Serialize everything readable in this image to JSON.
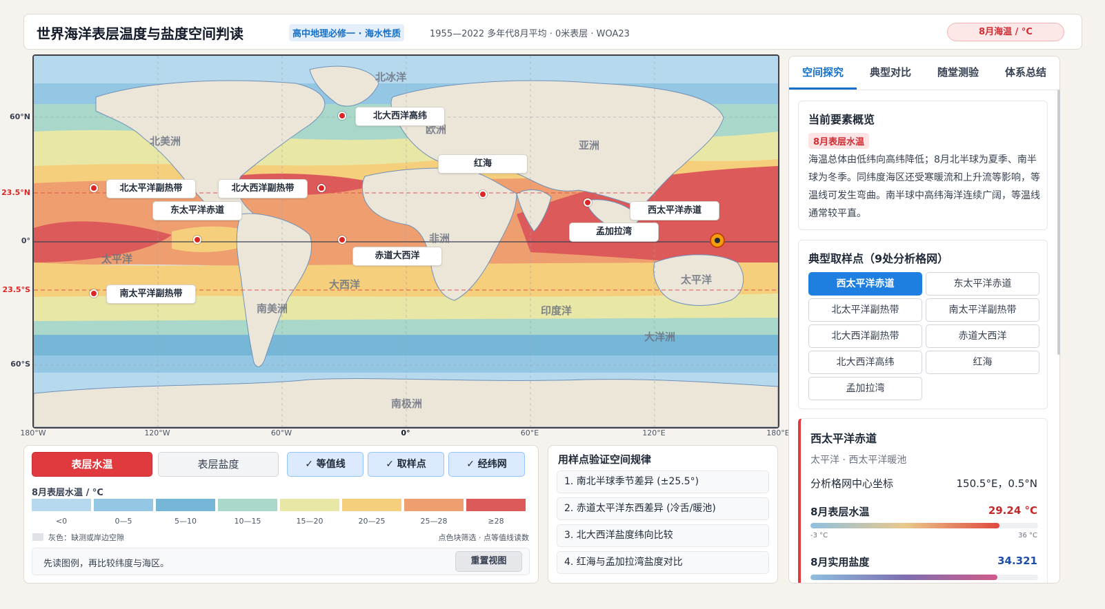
{
  "header": {
    "title": "世界海洋表层温度与盐度空间判读",
    "subject_tag": "高中地理必修一 · 海水性质",
    "meta": "1955—2022 多年代8月平均 · 0米表层 · WOA23",
    "mode_badge": "8月海温 / °C"
  },
  "map": {
    "lat_labels": [
      "60°N",
      "23.5°N",
      "0°",
      "23.5°S",
      "60°S"
    ],
    "lon_labels": [
      "180°W",
      "120°W",
      "60°W",
      "0°",
      "60°E",
      "120°E",
      "180°E"
    ],
    "continent_labels": [
      "北冰洋",
      "北美洲",
      "欧洲",
      "亚洲",
      "非洲",
      "太平洋",
      "大西洋",
      "南美洲",
      "印度洋",
      "太平洋",
      "大洋洲",
      "南极洲"
    ],
    "callouts": [
      "北大西洋高纬",
      "红海",
      "北太平洋副热带",
      "北大西洋副热带",
      "东太平洋赤道",
      "西太平洋赤道",
      "孟加拉湾",
      "赤道大西洋",
      "南太平洋副热带"
    ],
    "colors": {
      "lt0": "#b7d9ee",
      "c0_5": "#94c7e3",
      "c5_10": "#76b6d6",
      "c10_15": "#a9d8ca",
      "c15_20": "#e9e7a6",
      "c20_25": "#f5cf7c",
      "c25_28": "#ee9e6f",
      "ge28": "#dd5a5a",
      "land": "#ece6d9",
      "tropic_line": "#e05252"
    }
  },
  "controls": {
    "temp_btn": "表层水温",
    "salinity_btn": "表层盐度",
    "toggles": [
      "✓ 等值线",
      "✓ 取样点",
      "✓ 经纬网"
    ],
    "legend_title": "8月表层水温 / °C",
    "legend": [
      {
        "label": "<0",
        "color": "#b7d9ee"
      },
      {
        "label": "0—5",
        "color": "#94c7e3"
      },
      {
        "label": "5—10",
        "color": "#76b6d6"
      },
      {
        "label": "10—15",
        "color": "#a9d8ca"
      },
      {
        "label": "15—20",
        "color": "#e9e7a6"
      },
      {
        "label": "20—25",
        "color": "#f5cf7c"
      },
      {
        "label": "25—28",
        "color": "#ee9e6f"
      },
      {
        "label": "≥28",
        "color": "#dd5a5a"
      }
    ],
    "gray_note": "灰色：缺测或岸边空隙",
    "hint": "点色块筛选 · 点等值线读数",
    "tip": "先读图例，再比较纬度与海区。",
    "reset": "重置视图"
  },
  "verify": {
    "title": "用样点验证空间规律",
    "items": [
      "1. 南北半球季节差异 (±25.5°)",
      "2. 赤道太平洋东西差异 (冷舌/暖池)",
      "3. 北大西洋盐度纬向比较",
      "4. 红海与孟加拉湾盐度对比"
    ]
  },
  "sidebar": {
    "tabs": [
      "空间探究",
      "典型对比",
      "随堂测验",
      "体系总结"
    ],
    "overview": {
      "title": "当前要素概览",
      "tag": "8月表层水温",
      "text": "海温总体由低纬向高纬降低；8月北半球为夏季、南半球为冬季。同纬度海区还受寒暖流和上升流等影响，等温线可发生弯曲。南半球中高纬海洋连续广阔，等温线通常较平直。"
    },
    "points": {
      "title": "典型取样点（9处分析格网）",
      "items": [
        "西太平洋赤道",
        "东太平洋赤道",
        "北太平洋副热带",
        "南太平洋副热带",
        "北大西洋副热带",
        "赤道大西洋",
        "北大西洋高纬",
        "红海",
        "孟加拉湾"
      ]
    },
    "detail": {
      "title": "西太平洋赤道",
      "subtitle": "太平洋 · 西太平洋暖池",
      "coord_label": "分析格网中心坐标",
      "coord_value": "150.5°E，0.5°N",
      "temp_label": "8月表层水温",
      "temp_value": "29.24 °C",
      "temp_fraction": 0.83,
      "temp_min": "-3 °C",
      "temp_max": "36 °C",
      "sal_label": "8月实用盐度",
      "sal_value": "34.321",
      "sal_fraction": 0.82
    }
  }
}
